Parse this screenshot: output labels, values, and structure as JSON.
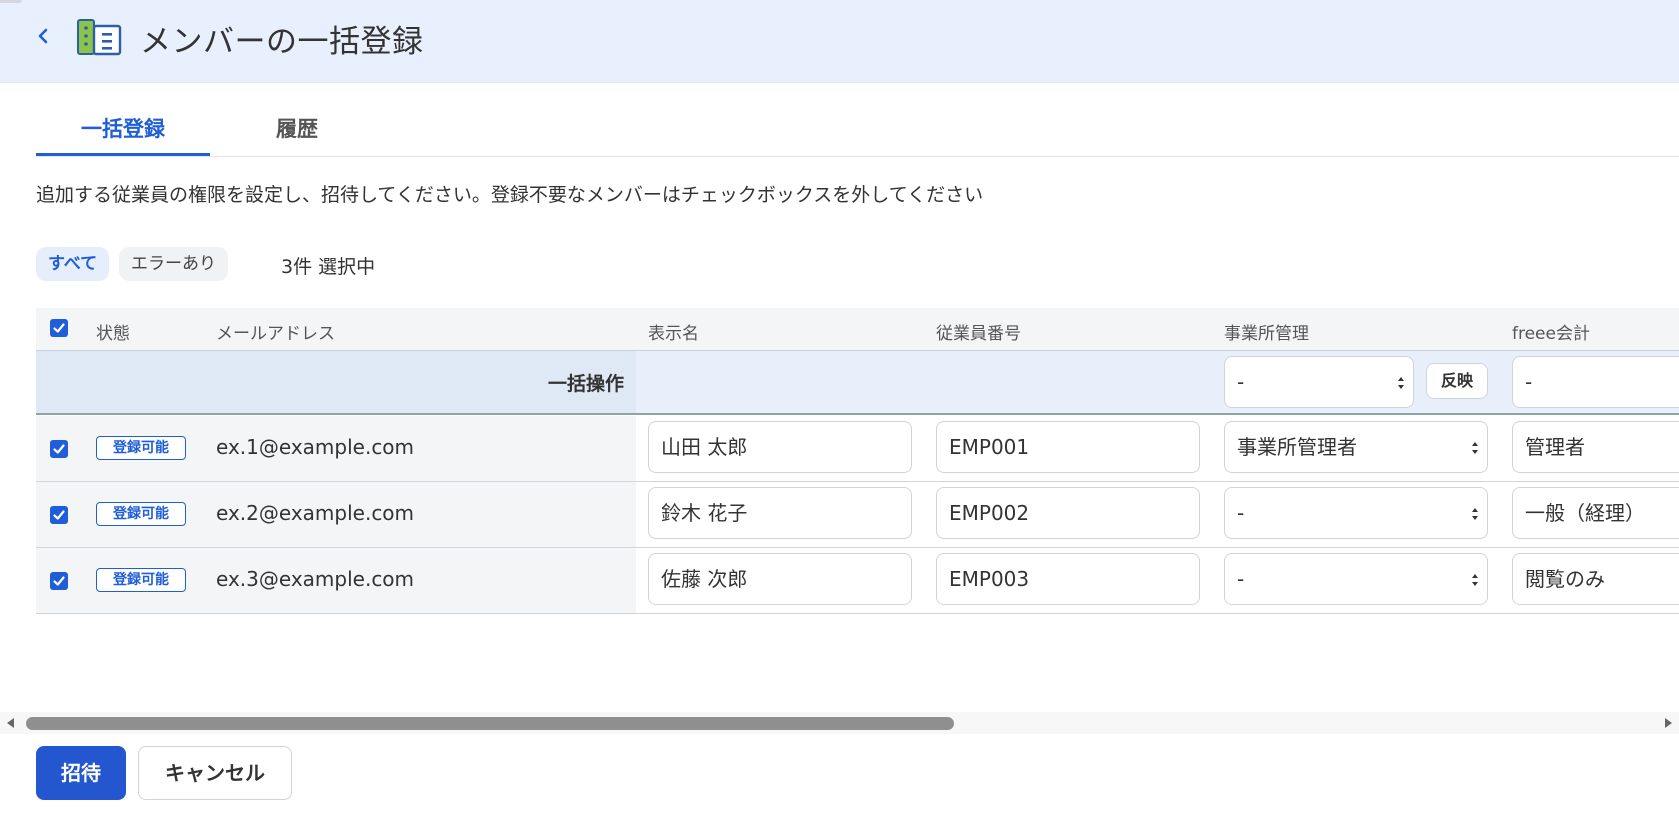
{
  "header": {
    "title": "メンバーの一括登録"
  },
  "tabs": [
    {
      "label": "一括登録"
    },
    {
      "label": "履歴"
    }
  ],
  "instruction": "追加する従業員の権限を設定し、招待してください。登録不要なメンバーはチェックボックスを外してください",
  "filters": {
    "all": "すべて",
    "errors": "エラーあり",
    "selected_count": "3件 選択中"
  },
  "table": {
    "columns": {
      "status": "状態",
      "email": "メールアドレス",
      "display_name": "表示名",
      "employee_number": "従業員番号",
      "office_admin": "事業所管理",
      "freee_accounting": "freee会計"
    },
    "bulk": {
      "label": "一括操作",
      "office_admin_value": "-",
      "apply_label": "反映",
      "accounting_value": "-"
    },
    "rows": [
      {
        "status": "登録可能",
        "email": "ex.1@example.com",
        "display_name": "山田 太郎",
        "employee_number": "EMP001",
        "office_admin": "事業所管理者",
        "accounting": "管理者"
      },
      {
        "status": "登録可能",
        "email": "ex.2@example.com",
        "display_name": "鈴木 花子",
        "employee_number": "EMP002",
        "office_admin": "-",
        "accounting": "一般（経理）"
      },
      {
        "status": "登録可能",
        "email": "ex.3@example.com",
        "display_name": "佐藤 次郎",
        "employee_number": "EMP003",
        "office_admin": "-",
        "accounting": "閲覧のみ"
      }
    ]
  },
  "actions": {
    "invite": "招待",
    "cancel": "キャンセル"
  },
  "colors": {
    "primary": "#1f5ed8",
    "button": "#2356cf",
    "header_bg": "#e9f0fd"
  },
  "icons": [
    "back-chevron-icon",
    "office-building-icon",
    "checkbox-checked-icon",
    "select-arrows-icon",
    "scroll-left-icon",
    "scroll-right-icon"
  ]
}
